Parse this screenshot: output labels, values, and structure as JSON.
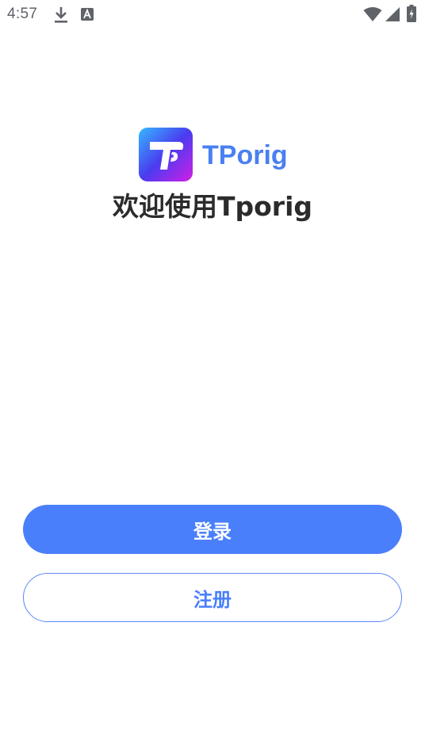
{
  "status_bar": {
    "time": "4:57",
    "icons": [
      "download-icon",
      "a-notification-icon",
      "wifi-icon",
      "signal-icon",
      "battery-charging-icon"
    ]
  },
  "brand": {
    "logo_letter": "T",
    "name": "TPorig",
    "name_color": "#4a80f2",
    "gradient": [
      "#35b8ff",
      "#4a3cf0",
      "#d21ee6"
    ]
  },
  "welcome": {
    "title": "欢迎使用Tporig"
  },
  "actions": {
    "login_label": "登录",
    "register_label": "注册",
    "accent_color": "#4a7ffc"
  }
}
